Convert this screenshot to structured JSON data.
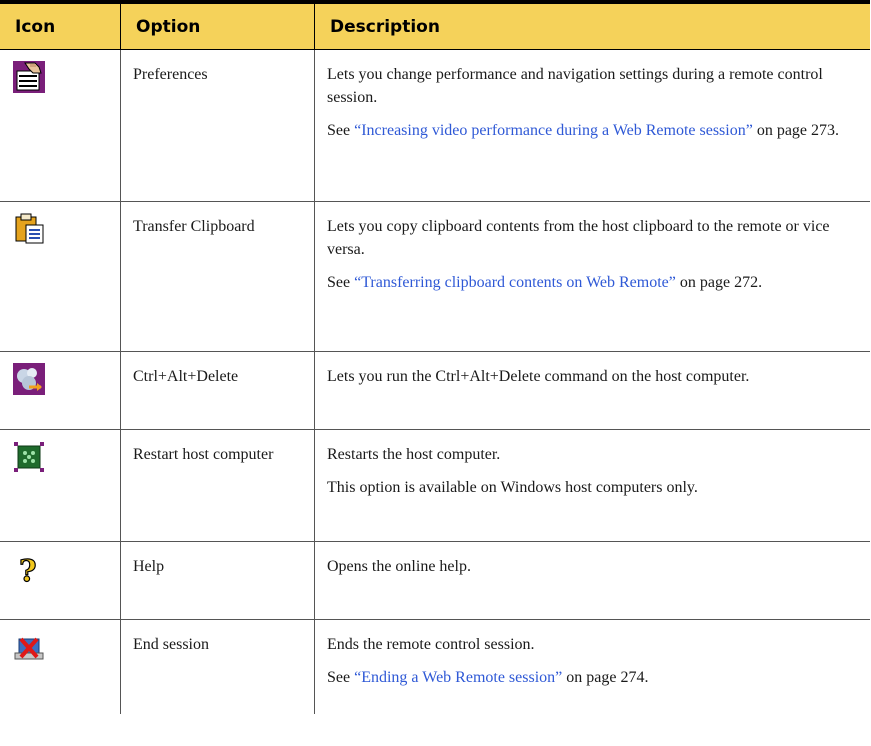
{
  "header": {
    "icon": "Icon",
    "option": "Option",
    "description": "Description"
  },
  "rows": [
    {
      "icon": "preferences-icon",
      "option": "Preferences",
      "desc1": "Lets you change performance and navigation settings during a remote control session.",
      "see_prefix": "See ",
      "link": "“Increasing video performance during a Web Remote session”",
      "see_suffix": " on page 273."
    },
    {
      "icon": "clipboard-icon",
      "option": "Transfer Clipboard",
      "desc1": "Lets you copy clipboard contents from the host clipboard to the remote or vice versa.",
      "see_prefix": "See ",
      "link": "“Transferring clipboard contents on Web Remote”",
      "see_suffix": " on page 272."
    },
    {
      "icon": "ctrl-alt-delete-icon",
      "option": "Ctrl+Alt+Delete",
      "desc1": "Lets you run the Ctrl+Alt+Delete command on the host computer."
    },
    {
      "icon": "restart-icon",
      "option": "Restart host computer",
      "desc1": "Restarts the host computer.",
      "desc2": "This option is available on Windows host computers only."
    },
    {
      "icon": "help-icon",
      "option": "Help",
      "desc1": "Opens the online help."
    },
    {
      "icon": "end-session-icon",
      "option": "End session",
      "desc1": "Ends the remote control session.",
      "see_prefix": "See ",
      "link": "“Ending a Web Remote session”",
      "see_suffix": " on page 274."
    }
  ],
  "colors": {
    "header_bg": "#f5d25a",
    "link": "#2f59d6",
    "icon_purple": "#7a1f7a"
  }
}
